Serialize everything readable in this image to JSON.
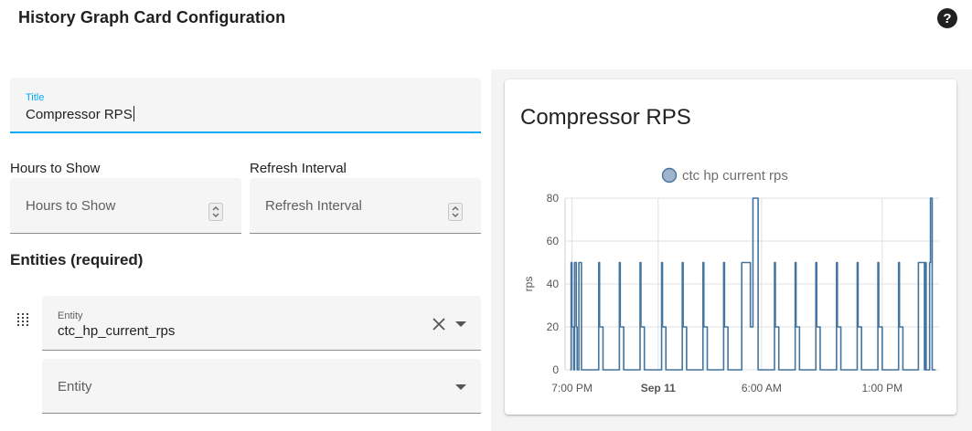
{
  "header": {
    "title": "History Graph Card Configuration",
    "help_icon": "help-circle-icon"
  },
  "form": {
    "title_field": {
      "label": "Title",
      "value": "Compressor RPS"
    },
    "hours_to_show": {
      "label": "Hours to Show",
      "placeholder": "Hours to Show"
    },
    "refresh_interval": {
      "label": "Refresh Interval",
      "placeholder": "Refresh Interval"
    },
    "entities_heading": "Entities (required)",
    "entity_rows": [
      {
        "label": "Entity",
        "value": "ctc_hp_current_rps"
      },
      {
        "label": "Entity",
        "value": ""
      }
    ]
  },
  "preview": {
    "card_title": "Compressor RPS",
    "colors": {
      "series": "#44739e",
      "legend_fill": "#a0b4cc",
      "grid": "#e0e0e0"
    }
  },
  "chart_data": {
    "type": "line",
    "title": "",
    "xlabel": "",
    "ylabel": "rps",
    "ylim": [
      0,
      80
    ],
    "y_ticks": [
      0,
      20,
      40,
      60,
      80
    ],
    "x_ticks": [
      "7:00 PM",
      "Sep 11",
      "6:00 AM",
      "1:00 PM"
    ],
    "x_tick_bold": [
      false,
      true,
      false,
      false
    ],
    "x_tick_hours": [
      0,
      5,
      11,
      18
    ],
    "x_range_hours": [
      -0.4,
      21.3
    ],
    "legend_position": "top-center",
    "grid": true,
    "series": [
      {
        "name": "ctc hp current rps",
        "x_hours": [
          -0.1,
          -0.05,
          0.0,
          0.1,
          0.15,
          0.2,
          0.25,
          0.3,
          0.35,
          0.4,
          0.45,
          0.55,
          1.5,
          1.55,
          1.6,
          1.75,
          1.8,
          1.95,
          2.0,
          2.7,
          2.75,
          2.8,
          2.95,
          3.0,
          3.15,
          3.2,
          3.9,
          3.95,
          4.0,
          4.15,
          4.2,
          4.35,
          4.4,
          5.15,
          5.2,
          5.25,
          5.4,
          5.45,
          5.6,
          5.65,
          6.35,
          6.4,
          6.45,
          6.6,
          6.65,
          6.8,
          6.85,
          7.55,
          7.6,
          7.65,
          7.8,
          7.85,
          8.0,
          8.05,
          8.75,
          8.8,
          8.85,
          9.0,
          9.05,
          9.2,
          9.25,
          9.8,
          9.85,
          10.3,
          10.35,
          10.5,
          10.8,
          10.85,
          11.05,
          11.1,
          11.7,
          11.75,
          11.8,
          11.95,
          12.0,
          12.15,
          12.2,
          12.9,
          12.95,
          13.0,
          13.15,
          13.2,
          13.35,
          13.4,
          14.1,
          14.15,
          14.2,
          14.35,
          14.4,
          14.55,
          14.6,
          15.3,
          15.35,
          15.4,
          15.55,
          15.6,
          15.75,
          15.8,
          16.5,
          16.55,
          16.6,
          16.75,
          16.8,
          16.95,
          17.0,
          17.7,
          17.75,
          17.8,
          17.95,
          18.0,
          18.15,
          18.2,
          18.9,
          18.95,
          19.0,
          19.15,
          19.2,
          19.35,
          19.4,
          20.05,
          20.1,
          20.4,
          20.45,
          20.5,
          20.55,
          20.75,
          20.8,
          20.85,
          20.9,
          21.05,
          21.1
        ],
        "values": [
          0,
          50,
          20,
          0,
          50,
          50,
          20,
          0,
          0,
          50,
          50,
          0,
          0,
          50,
          20,
          20,
          0,
          0,
          0,
          0,
          50,
          20,
          20,
          0,
          0,
          0,
          0,
          50,
          20,
          20,
          0,
          0,
          0,
          0,
          50,
          20,
          20,
          0,
          0,
          0,
          0,
          50,
          20,
          20,
          0,
          0,
          0,
          0,
          50,
          20,
          20,
          0,
          0,
          0,
          0,
          50,
          20,
          20,
          0,
          0,
          0,
          0,
          50,
          50,
          20,
          80,
          0,
          0,
          0,
          0,
          0,
          50,
          20,
          20,
          0,
          0,
          0,
          0,
          50,
          20,
          20,
          0,
          0,
          0,
          0,
          50,
          20,
          20,
          0,
          0,
          0,
          0,
          50,
          20,
          20,
          0,
          0,
          0,
          0,
          50,
          20,
          20,
          0,
          0,
          0,
          0,
          50,
          20,
          20,
          0,
          0,
          0,
          0,
          50,
          20,
          20,
          0,
          0,
          0,
          0,
          50,
          50,
          0,
          50,
          0,
          50,
          80,
          80,
          0,
          0,
          0,
          0
        ]
      }
    ]
  }
}
